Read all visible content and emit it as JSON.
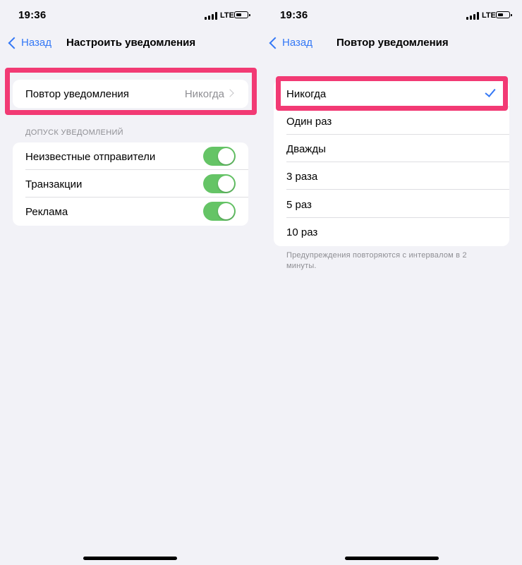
{
  "left_screen": {
    "status_bar": {
      "time": "19:36",
      "network": "LTE",
      "battery_icon": "battery-icon",
      "signal_icon": "cellular-signal-icon"
    },
    "nav": {
      "back_label": "Назад",
      "back_icon": "chevron-left-icon",
      "title": "Настроить уведомления"
    },
    "repeat_row": {
      "label": "Повтор уведомления",
      "value": "Никогда",
      "icon": "chevron-right-icon"
    },
    "section_header": "ДОПУСК УВЕДОМЛЕНИЙ",
    "toggles": [
      {
        "label": "Неизвестные отправители",
        "on": true
      },
      {
        "label": "Транзакции",
        "on": true
      },
      {
        "label": "Реклама",
        "on": true
      }
    ]
  },
  "right_screen": {
    "status_bar": {
      "time": "19:36",
      "network": "LTE",
      "battery_icon": "battery-icon",
      "signal_icon": "cellular-signal-icon"
    },
    "nav": {
      "back_label": "Назад",
      "back_icon": "chevron-left-icon",
      "title": "Повтор уведомления"
    },
    "options": [
      {
        "label": "Никогда",
        "selected": true
      },
      {
        "label": "Один раз",
        "selected": false
      },
      {
        "label": "Дважды",
        "selected": false
      },
      {
        "label": "3 раза",
        "selected": false
      },
      {
        "label": "5 раз",
        "selected": false
      },
      {
        "label": "10 раз",
        "selected": false
      }
    ],
    "selected_icon": "checkmark-icon",
    "footer": "Предупреждения повторяются с интервалом в 2 минуты."
  },
  "colors": {
    "accent": "#3478f6",
    "toggle_on": "#65c466",
    "highlight": "#f23a74",
    "background": "#f2f2f7",
    "secondary_text": "#8e8e93"
  }
}
